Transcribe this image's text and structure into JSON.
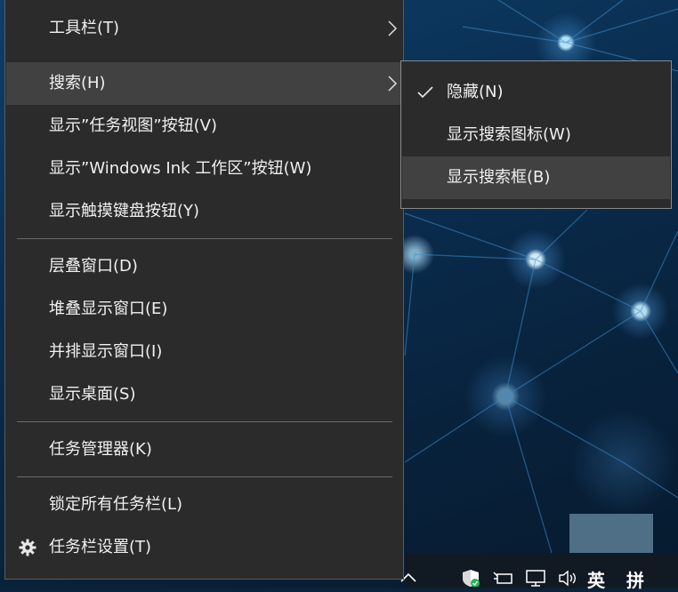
{
  "menu": {
    "items": [
      {
        "label": "工具栏(T)",
        "has_submenu": true
      },
      {
        "label": "搜索(H)",
        "has_submenu": true,
        "highlighted": true
      },
      {
        "label": "显示”任务视图”按钮(V)"
      },
      {
        "label": "显示”Windows Ink 工作区”按钮(W)"
      },
      {
        "label": "显示触摸键盘按钮(Y)"
      },
      {
        "label": "层叠窗口(D)"
      },
      {
        "label": "堆叠显示窗口(E)"
      },
      {
        "label": "并排显示窗口(I)"
      },
      {
        "label": "显示桌面(S)"
      },
      {
        "label": "任务管理器(K)"
      },
      {
        "label": "锁定所有任务栏(L)"
      },
      {
        "label": "任务栏设置(T)",
        "icon": "gear-icon"
      }
    ]
  },
  "submenu": {
    "items": [
      {
        "label": "隐藏(N)",
        "checked": true
      },
      {
        "label": "显示搜索图标(W)"
      },
      {
        "label": "显示搜索框(B)",
        "highlighted": true
      }
    ]
  },
  "tray": {
    "icons": [
      "chevron-up-icon",
      "security-shield-icon",
      "network-icon",
      "speaker-icon"
    ],
    "ime_lang": "英",
    "ime_mode": "拼"
  },
  "colors": {
    "menu_bg": "#2b2b2b",
    "highlight_bg": "#414141",
    "text": "#f0f0f0",
    "separator": "#6a6a6a",
    "shield_green": "#1db954"
  }
}
